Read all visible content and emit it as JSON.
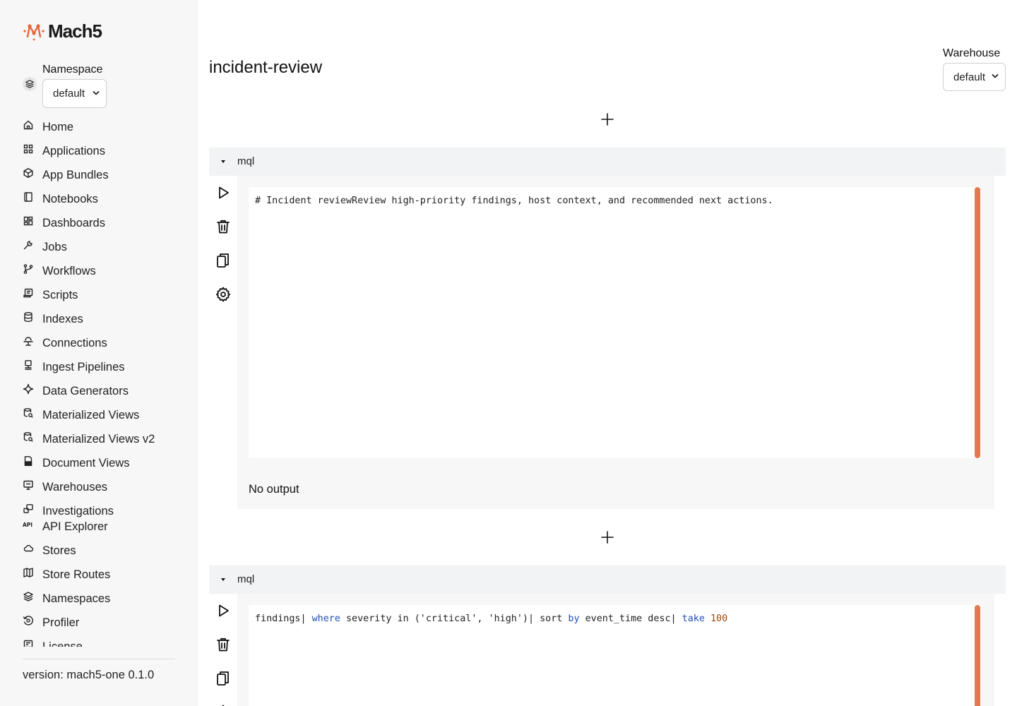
{
  "app": {
    "logo_text": "Mach5",
    "brand_color": "#e8643a"
  },
  "namespace": {
    "label": "Namespace",
    "selected": "default"
  },
  "nav": {
    "items": [
      {
        "label": "Home",
        "icon": "home-icon"
      },
      {
        "label": "Applications",
        "icon": "apps-grid-icon"
      },
      {
        "label": "App Bundles",
        "icon": "package-icon"
      },
      {
        "label": "Notebooks",
        "icon": "notebook-icon"
      },
      {
        "label": "Dashboards",
        "icon": "dashboard-icon"
      },
      {
        "label": "Jobs",
        "icon": "wrench-icon"
      },
      {
        "label": "Workflows",
        "icon": "git-branch-icon"
      },
      {
        "label": "Scripts",
        "icon": "script-icon"
      },
      {
        "label": "Indexes",
        "icon": "database-icon"
      },
      {
        "label": "Connections",
        "icon": "plug-icon"
      },
      {
        "label": "Ingest Pipelines",
        "icon": "pipeline-icon"
      },
      {
        "label": "Data Generators",
        "icon": "sparkle-icon"
      },
      {
        "label": "Materialized Views",
        "icon": "db-search-icon"
      },
      {
        "label": "Materialized Views v2",
        "icon": "db-search-icon"
      },
      {
        "label": "Document Views",
        "icon": "document-icon"
      },
      {
        "label": "Warehouses",
        "icon": "monitor-icon"
      },
      {
        "label": "Investigations",
        "icon": "investigation-icon"
      },
      {
        "label": "API Explorer",
        "icon": "api-icon"
      },
      {
        "label": "Stores",
        "icon": "cloud-icon"
      },
      {
        "label": "Store Routes",
        "icon": "map-icon"
      },
      {
        "label": "Namespaces",
        "icon": "layers-icon"
      },
      {
        "label": "Profiler",
        "icon": "profiler-icon"
      },
      {
        "label": "License",
        "icon": "license-icon"
      }
    ]
  },
  "footer": {
    "version": "version: mach5-one 0.1.0"
  },
  "page": {
    "title": "incident-review"
  },
  "warehouse": {
    "label": "Warehouse",
    "selected": "default"
  },
  "cells": [
    {
      "lang": "mql",
      "code": "# Incident reviewReview high-priority findings, host context, and recommended next actions.",
      "output": "No output"
    },
    {
      "lang": "mql",
      "code_parts": {
        "p1": "findings| ",
        "k1": "where",
        "p2": " severity in ('critical', 'high')| sort ",
        "k2": "by",
        "p3": " event_time desc| ",
        "k3": "take",
        "p4": " ",
        "n1": "100"
      }
    }
  ]
}
